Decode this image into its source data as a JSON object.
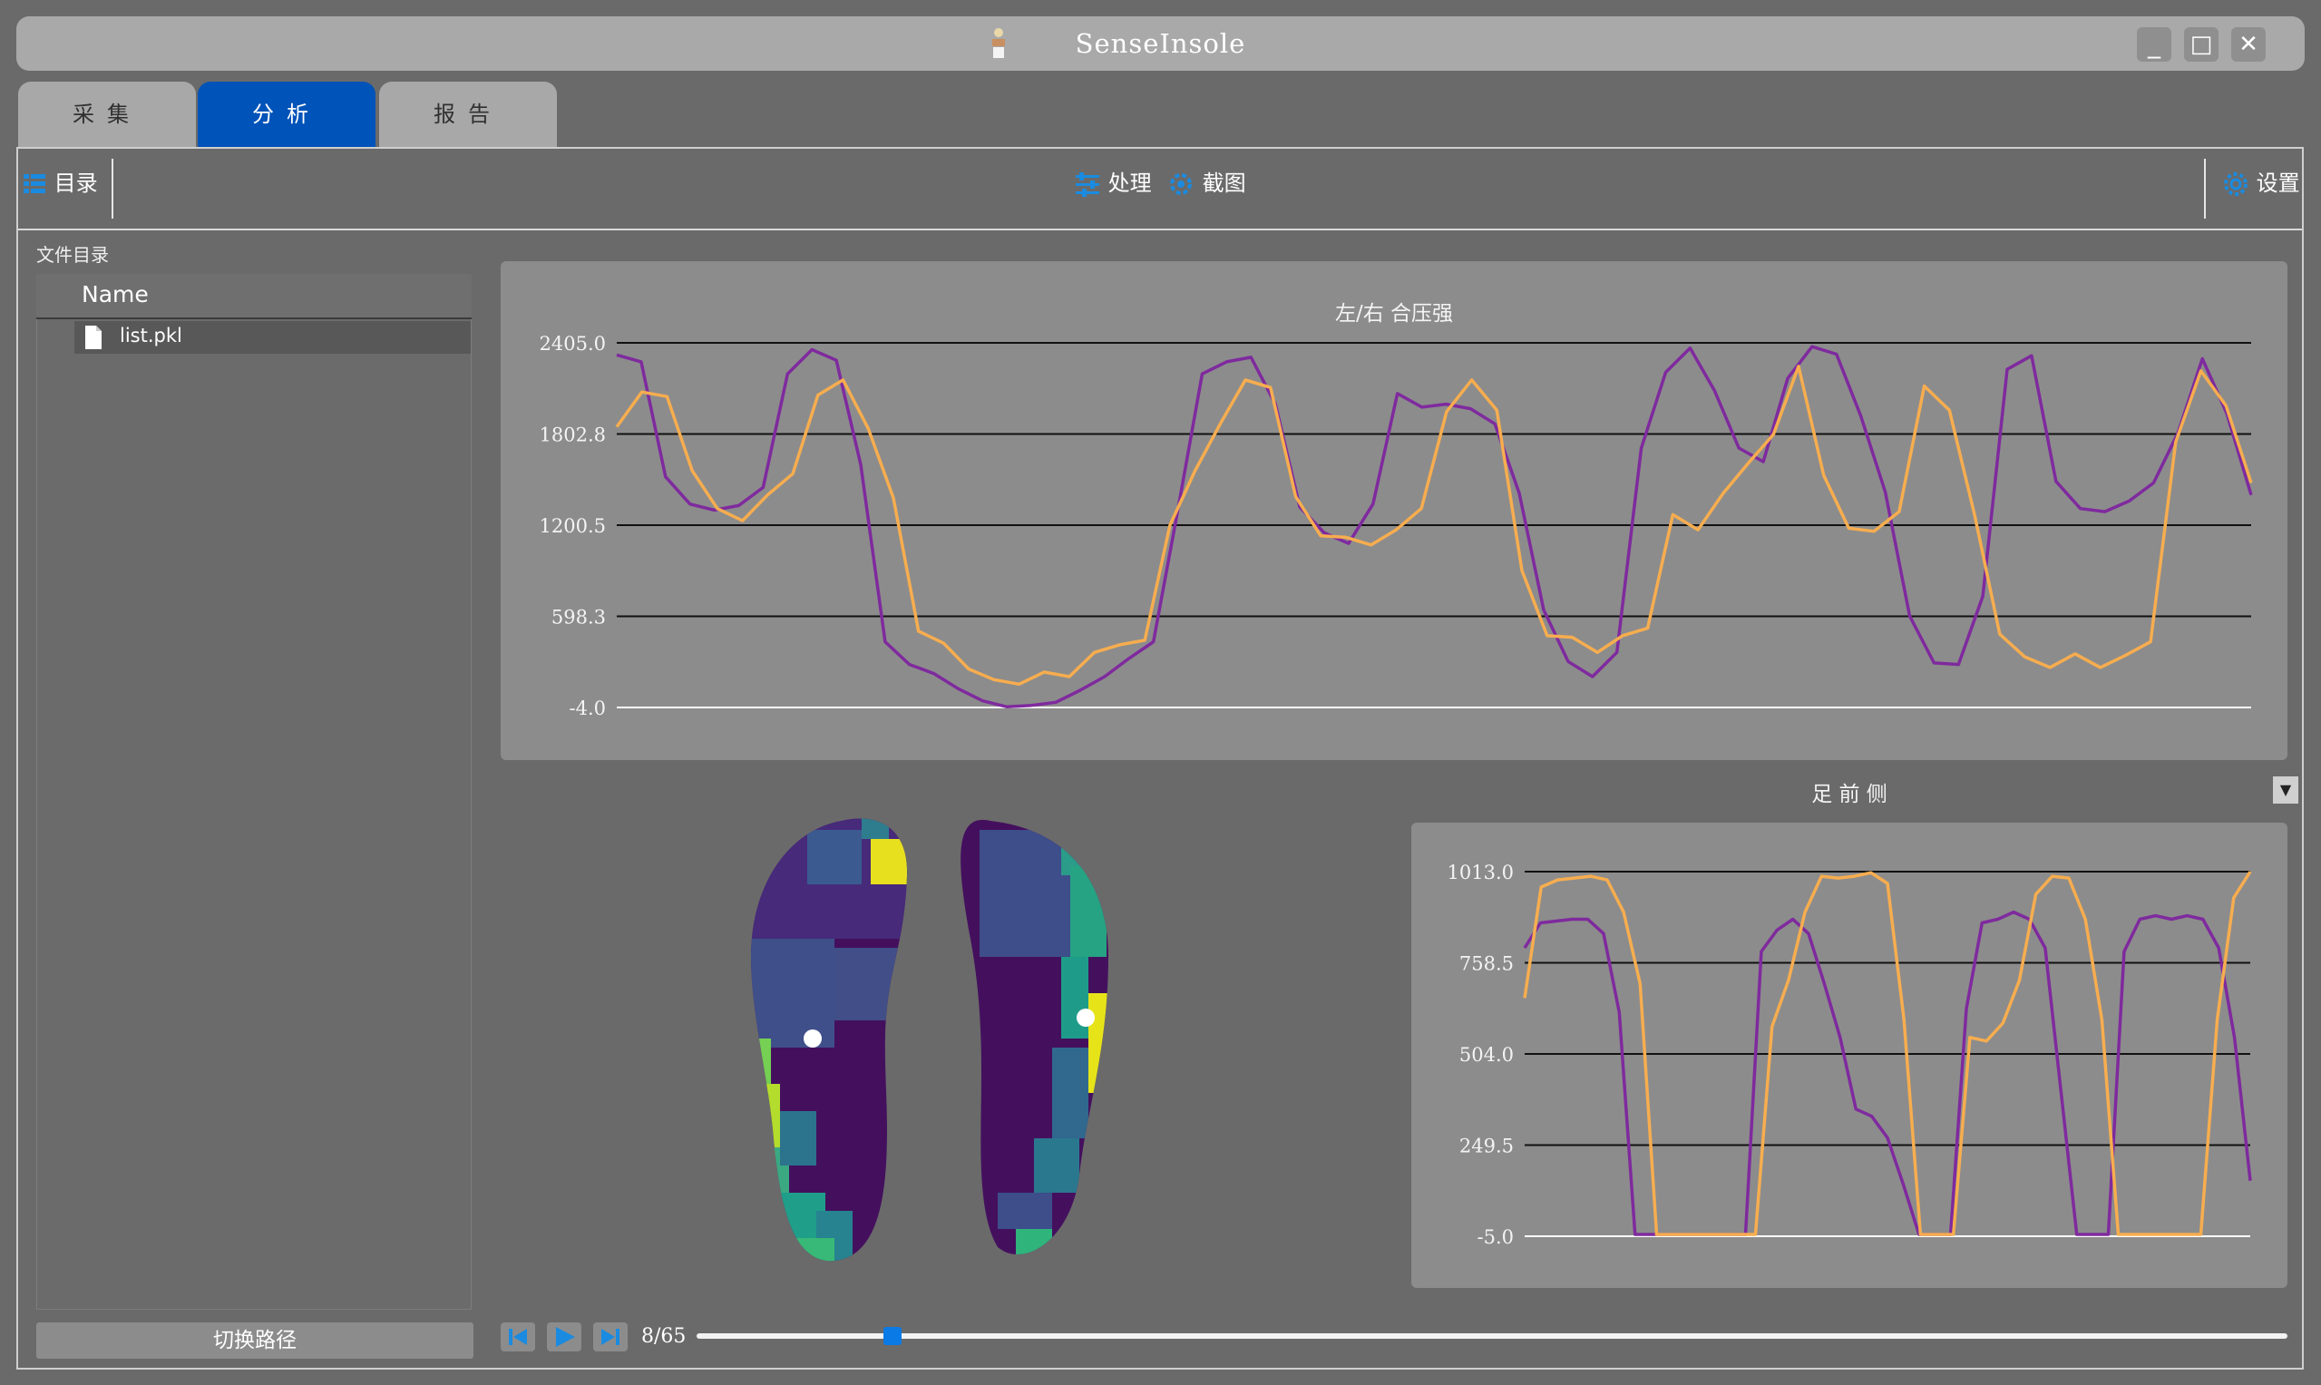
{
  "window": {
    "title": "SenseInsole",
    "minimize": "_",
    "maximize": "□",
    "close": "✕"
  },
  "tabs": [
    {
      "label": "采集",
      "active": false
    },
    {
      "label": "分析",
      "active": true
    },
    {
      "label": "报告",
      "active": false
    }
  ],
  "toolbar": {
    "catalog_label": "目录",
    "process_label": "处理",
    "screenshot_label": "截图",
    "settings_label": "设置"
  },
  "file_panel": {
    "title": "文件目录",
    "column_name": "Name",
    "files": [
      "list.pkl"
    ],
    "switch_path_label": "切换路径"
  },
  "player": {
    "current_frame": 8,
    "total_frames": 65,
    "counter_text": "8/65",
    "progress": 0.123
  },
  "region_selector": {
    "selected": "足 前 侧"
  },
  "colors": {
    "left_series": "#7f2a9e",
    "right_series": "#f7ad4f",
    "active_tab": "#0053b8",
    "accent": "#1a8be0"
  },
  "chart_data": [
    {
      "type": "line",
      "title": "左/右 合压强",
      "ylim": [
        -4.0,
        2405.0
      ],
      "yticks": [
        "2405.0",
        "1802.8",
        "1200.5",
        "598.3",
        "-4.0"
      ],
      "grid": true,
      "series": [
        {
          "color": "#7f2a9e",
          "values": [
            2325,
            2280,
            1520,
            1340,
            1300,
            1330,
            1450,
            2200,
            2360,
            2290,
            1600,
            430,
            280,
            220,
            120,
            40,
            0,
            10,
            30,
            110,
            200,
            320,
            430,
            1300,
            2200,
            2280,
            2310,
            2000,
            1320,
            1150,
            1080,
            1340,
            2070,
            1980,
            2000,
            1970,
            1870,
            1410,
            640,
            300,
            200,
            360,
            1710,
            2210,
            2370,
            2090,
            1710,
            1620,
            2170,
            2380,
            2330,
            1920,
            1420,
            600,
            290,
            280,
            730,
            2230,
            2320,
            1490,
            1310,
            1290,
            1360,
            1480,
            1810,
            2300,
            1940,
            1400
          ]
        },
        {
          "color": "#f7ad4f",
          "values": [
            1850,
            2080,
            2050,
            1560,
            1310,
            1230,
            1400,
            1540,
            2060,
            2160,
            1840,
            1380,
            500,
            420,
            250,
            180,
            150,
            230,
            200,
            360,
            410,
            440,
            1200,
            1560,
            1870,
            2160,
            2110,
            1390,
            1130,
            1120,
            1070,
            1170,
            1310,
            1950,
            2160,
            1960,
            900,
            470,
            460,
            360,
            470,
            520,
            1270,
            1170,
            1410,
            1610,
            1800,
            2250,
            1530,
            1180,
            1160,
            1290,
            2120,
            1960,
            1270,
            480,
            330,
            260,
            350,
            260,
            340,
            430,
            1750,
            2220,
            1990,
            1480
          ]
        }
      ]
    },
    {
      "type": "line",
      "title": "足 前 侧",
      "ylim": [
        -5.0,
        1013.0
      ],
      "yticks": [
        "1013.0",
        "758.5",
        "504.0",
        "249.5",
        "-5.0"
      ],
      "grid": true,
      "series": [
        {
          "color": "#7f2a9e",
          "values": [
            800,
            870,
            875,
            880,
            880,
            840,
            620,
            0,
            0,
            0,
            0,
            0,
            0,
            0,
            0,
            790,
            850,
            880,
            840,
            700,
            550,
            350,
            330,
            270,
            140,
            0,
            0,
            0,
            630,
            870,
            880,
            900,
            880,
            800,
            400,
            0,
            0,
            0,
            790,
            880,
            890,
            880,
            890,
            880,
            800,
            550,
            150
          ]
        },
        {
          "color": "#f7ad4f",
          "values": [
            660,
            970,
            990,
            995,
            1000,
            990,
            900,
            700,
            0,
            0,
            0,
            0,
            0,
            0,
            0,
            580,
            710,
            900,
            1000,
            995,
            1000,
            1010,
            980,
            600,
            0,
            0,
            0,
            550,
            540,
            590,
            710,
            950,
            1000,
            995,
            880,
            600,
            0,
            0,
            0,
            0,
            0,
            0,
            600,
            940,
            1013
          ]
        }
      ]
    }
  ]
}
